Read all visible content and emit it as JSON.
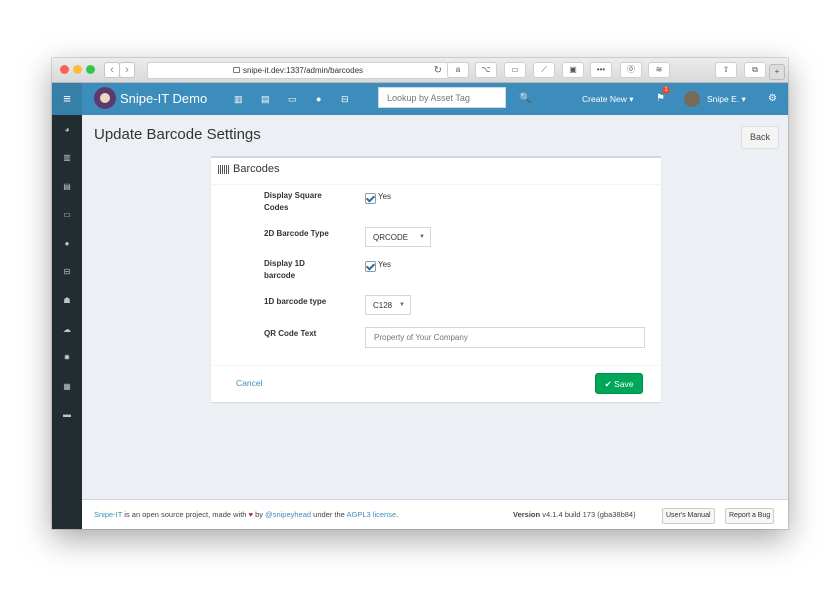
{
  "browser": {
    "url": "snipe-it.dev:1337/admin/barcodes",
    "back_glyph": "‹",
    "forward_glyph": "›",
    "reload_glyph": "↻",
    "toolbar_icons": [
      "amazon-icon",
      "option-icon",
      "keyboard-icon",
      "pin-icon",
      "lock-icon",
      "password-dots-icon",
      "onepassword-icon",
      "layers-icon",
      "share-icon",
      "tabs-icon"
    ],
    "new_tab_glyph": "+"
  },
  "navbar": {
    "menu_glyph": "≡",
    "brand": "Snipe-IT Demo",
    "search_placeholder": "Lookup by Asset Tag",
    "search_glyph": "🔍",
    "create_new": "Create New ▾",
    "notification_count": "1",
    "user": "Snipe E. ▾",
    "settings_glyph": "⚙"
  },
  "sidebar": {
    "icons": [
      "dashboard-icon",
      "assets-icon",
      "licenses-icon",
      "accessories-icon",
      "consumables-icon",
      "components-icon",
      "users-icon",
      "import-icon",
      "settings-icon",
      "reports-icon",
      "requestable-icon"
    ]
  },
  "page": {
    "title": "Update Barcode Settings",
    "back_button": "Back"
  },
  "form": {
    "box_title": "Barcodes",
    "display_square_label_1": "Display Square",
    "display_square_label_2": "Codes",
    "display_square_value": "Yes",
    "barcode_2d_label": "2D Barcode Type",
    "barcode_2d_value": "QRCODE",
    "display_1d_label_1": "Display 1D",
    "display_1d_label_2": "barcode",
    "display_1d_value": "Yes",
    "barcode_1d_label": "1D barcode type",
    "barcode_1d_value": "C128",
    "qr_text_label": "QR Code Text",
    "qr_text_placeholder": "Property of Your Company",
    "cancel": "Cancel",
    "save": "✔ Save"
  },
  "footer": {
    "snipeit_link": "Snipe-IT",
    "text1": " is an open source project, made with ",
    "heart": "♥",
    "text2": " by ",
    "author_link": "@snipeyhead",
    "text3": " under the ",
    "license_link": "AGPL3 license",
    "text4": ".",
    "version_label": "Version",
    "version_value": " v4.1.4 build 173 (gba38b84)",
    "manual_button": "User's Manual",
    "bug_button": "Report a Bug"
  },
  "colors": {
    "navbar": "#3c8dbc",
    "sidebar": "#222d32",
    "save": "#00a65a"
  }
}
